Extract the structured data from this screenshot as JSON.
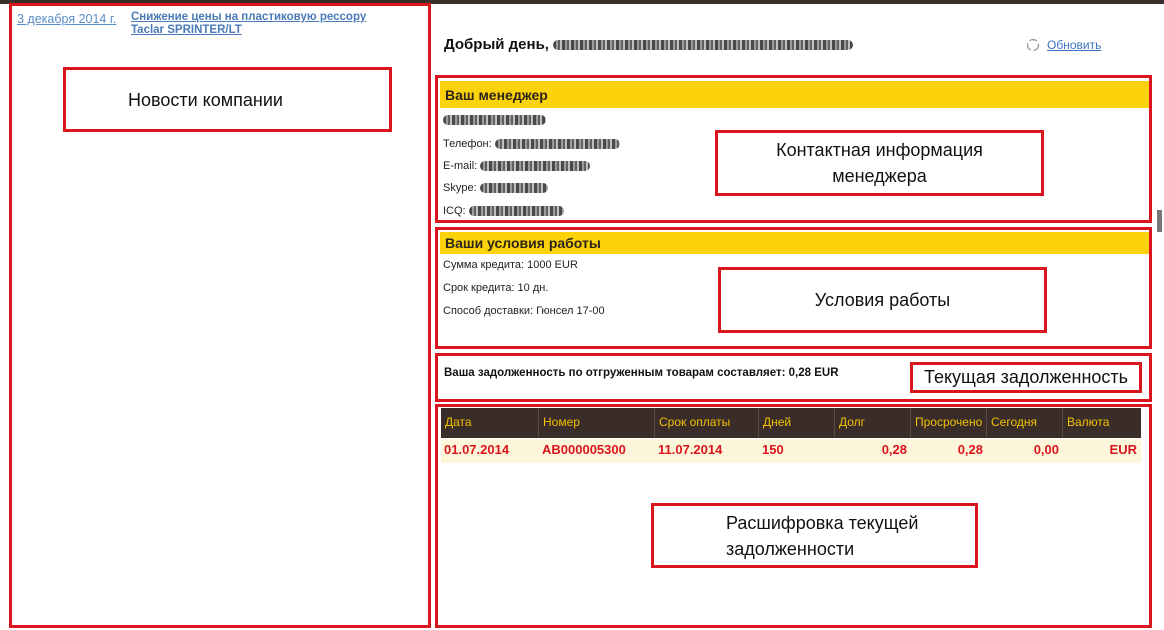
{
  "news": {
    "date": "3 декабря 2014 г.",
    "title": "Снижение цены на  пластиковую рессору Taclar SPRINTER/LT",
    "annotation": "Новости компании"
  },
  "header": {
    "greeting": "Добрый день,",
    "refresh_label": "Обновить"
  },
  "manager": {
    "title": "Ваш  менеджер",
    "phone_label": "Телефон:",
    "email_label": "E-mail:",
    "skype_label": "Skype:",
    "icq_label": "ICQ:",
    "annotation": "Контактная информация менеджера"
  },
  "terms": {
    "title": "Ваши условия работы",
    "credit_sum": "Сумма кредита: 1000 EUR",
    "credit_term": "Срок кредита: 10 дн.",
    "delivery": "Способ доставки: Гюнсел 17-00",
    "annotation": "Условия работы"
  },
  "debt": {
    "text": "Ваша задолженность по отгруженным товарам составляет: 0,28 EUR",
    "annotation": "Текущая задолженность"
  },
  "table": {
    "headers": [
      "Дата",
      "Номер",
      "Срок оплаты",
      "Дней",
      "Долг",
      "Просрочено",
      "Сегодня",
      "Валюта"
    ],
    "rows": [
      [
        "01.07.2014",
        "AB000005300",
        "11.07.2014",
        "150",
        "0,28",
        "0,28",
        "0,00",
        "EUR"
      ]
    ],
    "annotation": "Расшифровка текущей задолженности"
  },
  "colors": {
    "accent_yellow": "#fcd30b",
    "annotation_red": "#d9161d",
    "header_dark": "#3a2d29"
  },
  "icons": {
    "refresh": "refresh-icon"
  }
}
